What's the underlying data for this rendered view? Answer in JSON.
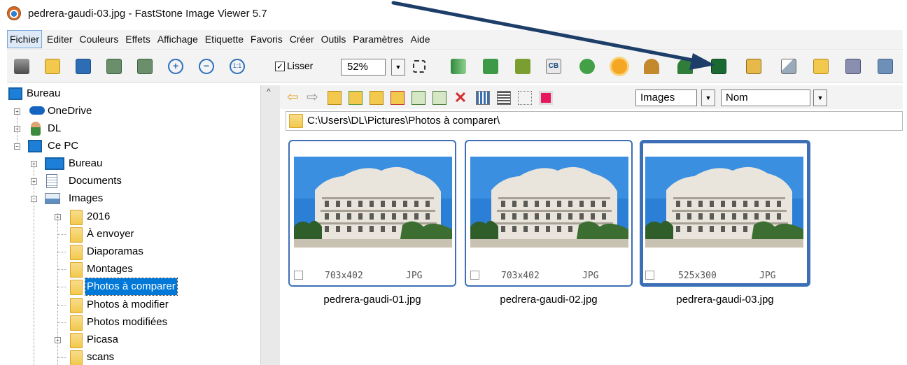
{
  "window": {
    "title": "pedrera-gaudi-03.jpg  -  FastStone Image Viewer 5.7"
  },
  "menu": [
    "Fichier",
    "Editer",
    "Couleurs",
    "Effets",
    "Affichage",
    "Etiquette",
    "Favoris",
    "Créer",
    "Outils",
    "Paramètres",
    "Aide"
  ],
  "toolbar": {
    "smooth_label": "Lisser",
    "smooth_checked": true,
    "zoom_value": "52%"
  },
  "tree": {
    "items": [
      {
        "label": "Bureau",
        "icon": "desktop-icon"
      },
      {
        "label": "OneDrive",
        "icon": "cloud-icon"
      },
      {
        "label": "DL",
        "icon": "user-icon"
      },
      {
        "label": "Ce PC",
        "icon": "computer-icon"
      },
      {
        "label": "Bureau",
        "icon": "desktop-icon"
      },
      {
        "label": "Documents",
        "icon": "documents-icon"
      },
      {
        "label": "Images",
        "icon": "pictures-icon"
      },
      {
        "label": "2016",
        "icon": "folder-icon"
      },
      {
        "label": "À envoyer",
        "icon": "folder-icon"
      },
      {
        "label": "Diaporamas",
        "icon": "folder-icon"
      },
      {
        "label": "Montages",
        "icon": "folder-icon"
      },
      {
        "label": "Photos à comparer",
        "icon": "folder-icon",
        "selected": true
      },
      {
        "label": "Photos à modifier",
        "icon": "folder-icon"
      },
      {
        "label": "Photos modifiées",
        "icon": "folder-icon"
      },
      {
        "label": "Picasa",
        "icon": "folder-icon"
      },
      {
        "label": "scans",
        "icon": "folder-icon"
      }
    ]
  },
  "browser": {
    "filter_value": "Images",
    "sort_value": "Nom",
    "path": "C:\\Users\\DL\\Pictures\\Photos à comparer\\"
  },
  "thumbnails": [
    {
      "name": "pedrera-gaudi-01.jpg",
      "dimensions": "703x402",
      "type": "JPG",
      "current": false
    },
    {
      "name": "pedrera-gaudi-02.jpg",
      "dimensions": "703x402",
      "type": "JPG",
      "current": false
    },
    {
      "name": "pedrera-gaudi-03.jpg",
      "dimensions": "525x300",
      "type": "JPG",
      "current": true
    }
  ],
  "colors": {
    "selection": "#0078d7",
    "thumb_border": "#3d6fb6",
    "arrow": "#1d3e68"
  }
}
